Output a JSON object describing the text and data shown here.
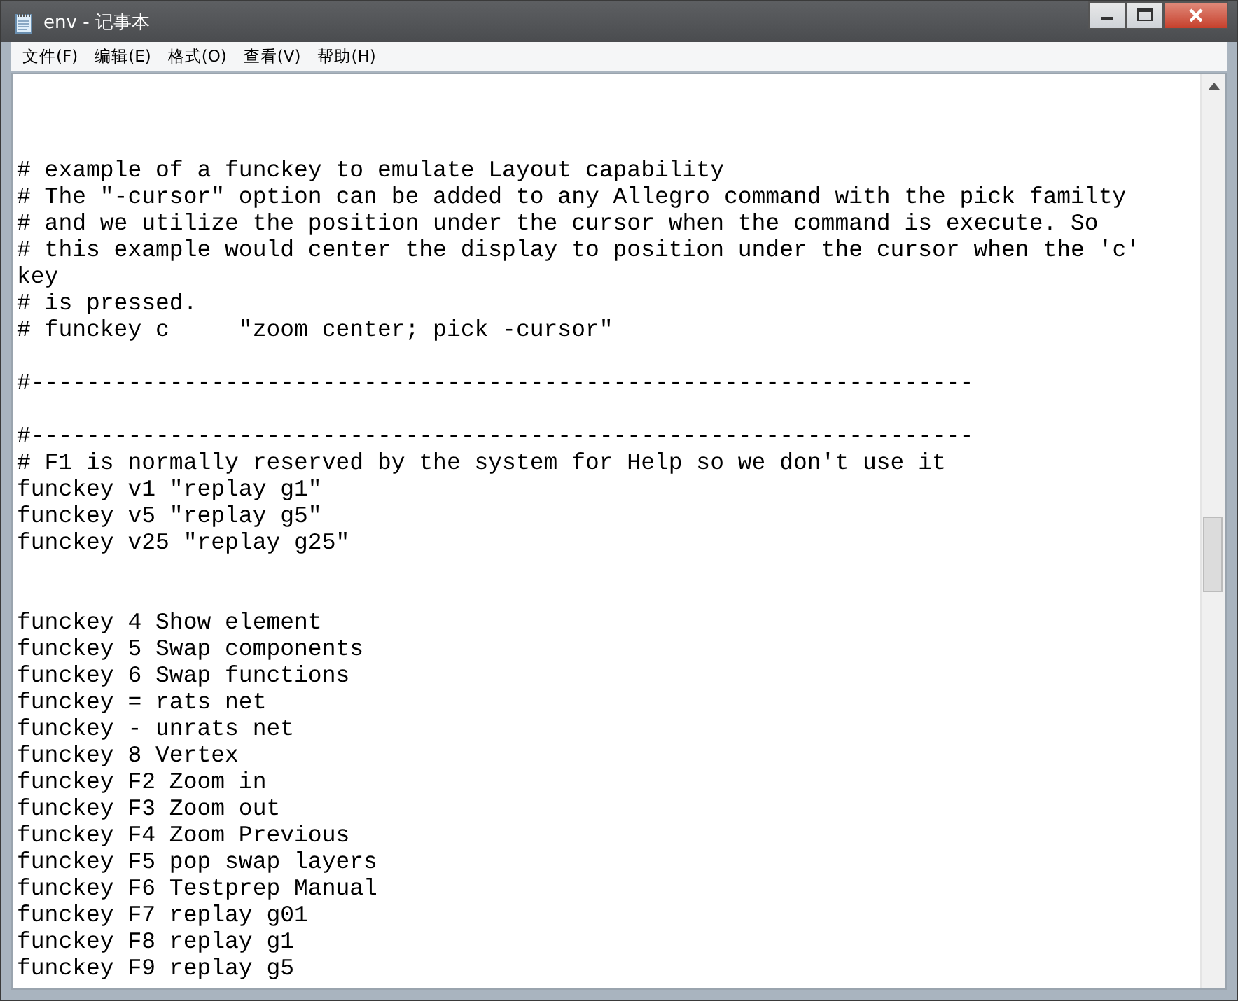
{
  "window": {
    "title": "env - 记事本"
  },
  "menu": [
    {
      "label": "文件(F)"
    },
    {
      "label": "编辑(E)"
    },
    {
      "label": "格式(O)"
    },
    {
      "label": "查看(V)"
    },
    {
      "label": "帮助(H)"
    }
  ],
  "lines": [
    {
      "kind": "blank"
    },
    {
      "kind": "blank"
    },
    {
      "kind": "blank"
    },
    {
      "kind": "text",
      "text": "# example of a funckey to emulate Layout capability"
    },
    {
      "kind": "text",
      "text": "# The \"-cursor\" option can be added to any Allegro command with the pick familty"
    },
    {
      "kind": "text",
      "text": "# and we utilize the position under the cursor when the command is execute. So"
    },
    {
      "kind": "text",
      "text": "# this example would center the display to position under the cursor when the 'c'"
    },
    {
      "kind": "text",
      "text": "key"
    },
    {
      "kind": "text",
      "text": "# is pressed."
    },
    {
      "kind": "text",
      "text": "# funckey c     \"zoom center; pick -cursor\""
    },
    {
      "kind": "blank"
    },
    {
      "kind": "text",
      "text": "#--------------------------------------------------------------------"
    },
    {
      "kind": "blank"
    },
    {
      "kind": "text",
      "text": "#--------------------------------------------------------------------"
    },
    {
      "kind": "text",
      "text": "# F1 is normally reserved by the system for Help so we don't use it"
    },
    {
      "kind": "text",
      "text": "funckey v1 \"replay g1\""
    },
    {
      "kind": "text",
      "text": "funckey v5 \"replay g5\""
    },
    {
      "kind": "text",
      "text": "funckey v25 \"replay g25\""
    },
    {
      "kind": "blank"
    },
    {
      "kind": "blank"
    },
    {
      "kind": "text",
      "text": "funckey 4 Show element"
    },
    {
      "kind": "text",
      "text": "funckey 5 Swap components"
    },
    {
      "kind": "text",
      "text": "funckey 6 Swap functions"
    },
    {
      "kind": "text",
      "text": "funckey = rats net"
    },
    {
      "kind": "text",
      "text": "funckey - unrats net"
    },
    {
      "kind": "text",
      "text": "funckey 8 Vertex"
    },
    {
      "kind": "text",
      "text": "funckey F2 Zoom in"
    },
    {
      "kind": "text",
      "text": "funckey F3 Zoom out"
    },
    {
      "kind": "text",
      "text": "funckey F4 Zoom Previous"
    },
    {
      "kind": "text",
      "text": "funckey F5 pop swap layers"
    },
    {
      "kind": "text",
      "text": "funckey F6 Testprep Manual"
    },
    {
      "kind": "text",
      "text": "funckey F7 replay g01"
    },
    {
      "kind": "text",
      "text": "funckey F8 replay g1"
    },
    {
      "kind": "text",
      "text": "funckey F9 replay g5"
    }
  ]
}
